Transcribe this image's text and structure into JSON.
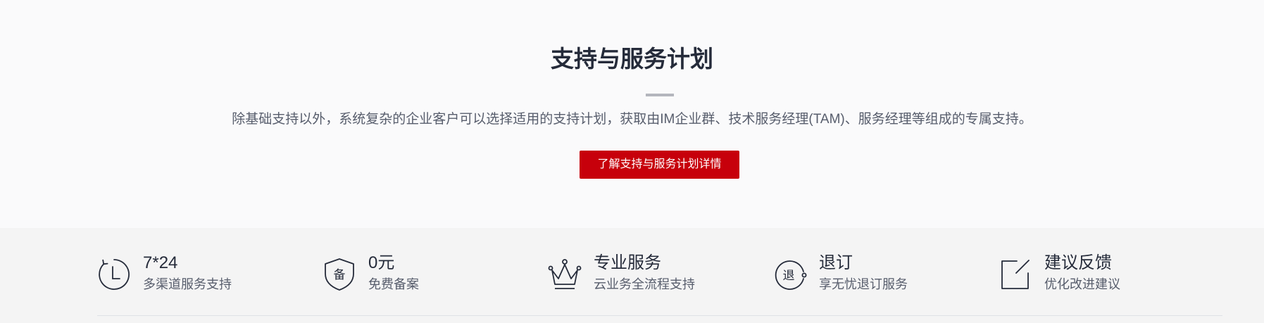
{
  "hero": {
    "title": "支持与服务计划",
    "description": "除基础支持以外，系统复杂的企业客户可以选择适用的支持计划，获取由IM企业群、技术服务经理(TAM)、服务经理等组成的专属支持。",
    "button_label": "了解支持与服务计划详情",
    "accent_color": "#c7000b"
  },
  "features": [
    {
      "icon": "clock-icon",
      "title": "7*24",
      "subtitle": "多渠道服务支持"
    },
    {
      "icon": "shield-icon",
      "icon_text": "备",
      "title": "0元",
      "subtitle": "免费备案"
    },
    {
      "icon": "crown-icon",
      "title": "专业服务",
      "subtitle": "云业务全流程支持"
    },
    {
      "icon": "refund-icon",
      "icon_text": "退",
      "title": "退订",
      "subtitle": "享无忧退订服务"
    },
    {
      "icon": "edit-icon",
      "title": "建议反馈",
      "subtitle": "优化改进建议"
    }
  ]
}
